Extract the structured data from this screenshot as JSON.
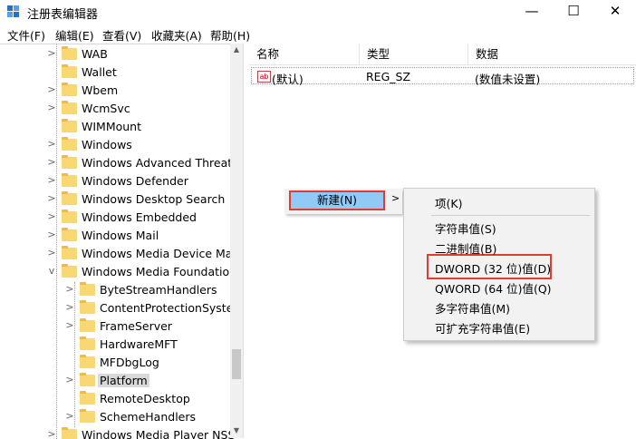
{
  "window": {
    "title": "注册表编辑器",
    "minimize": "—",
    "maximize": "☐",
    "close": "✕"
  },
  "menu": [
    "文件(F)",
    "编辑(E)",
    "查看(V)",
    "收藏夹(A)",
    "帮助(H)"
  ],
  "tree": [
    {
      "label": "WAB",
      "level": 1,
      "exp": ">"
    },
    {
      "label": "Wallet",
      "level": 1,
      "exp": ""
    },
    {
      "label": "Wbem",
      "level": 1,
      "exp": ">"
    },
    {
      "label": "WcmSvc",
      "level": 1,
      "exp": ">"
    },
    {
      "label": "WIMMount",
      "level": 1,
      "exp": ""
    },
    {
      "label": "Windows",
      "level": 1,
      "exp": ">"
    },
    {
      "label": "Windows Advanced Threat P",
      "level": 1,
      "exp": ">"
    },
    {
      "label": "Windows Defender",
      "level": 1,
      "exp": ">"
    },
    {
      "label": "Windows Desktop Search",
      "level": 1,
      "exp": ">"
    },
    {
      "label": "Windows Embedded",
      "level": 1,
      "exp": ">"
    },
    {
      "label": "Windows Mail",
      "level": 1,
      "exp": ">"
    },
    {
      "label": "Windows Media Device Man",
      "level": 1,
      "exp": ">"
    },
    {
      "label": "Windows Media Foundation",
      "level": 1,
      "exp": "v"
    },
    {
      "label": "ByteStreamHandlers",
      "level": 2,
      "exp": ">"
    },
    {
      "label": "ContentProtectionSystem",
      "level": 2,
      "exp": ">"
    },
    {
      "label": "FrameServer",
      "level": 2,
      "exp": ">"
    },
    {
      "label": "HardwareMFT",
      "level": 2,
      "exp": ""
    },
    {
      "label": "MFDbgLog",
      "level": 2,
      "exp": ""
    },
    {
      "label": "Platform",
      "level": 2,
      "exp": ">",
      "selected": true
    },
    {
      "label": "RemoteDesktop",
      "level": 2,
      "exp": ""
    },
    {
      "label": "SchemeHandlers",
      "level": 2,
      "exp": ">"
    },
    {
      "label": "Windows Media Player NSS",
      "level": 1,
      "exp": ">"
    }
  ],
  "columns": {
    "name": "名称",
    "type": "类型",
    "data": "数据"
  },
  "values": [
    {
      "icon": "ab",
      "name": "(默认)",
      "type": "REG_SZ",
      "data": "(数值未设置)"
    }
  ],
  "context_menu": {
    "new_label": "新建(N)",
    "arrow": ">"
  },
  "submenu": [
    {
      "label": "项(K)"
    },
    {
      "label": "字符串值(S)"
    },
    {
      "label": "二进制值(B)"
    },
    {
      "label": "DWORD (32 位)值(D)",
      "highlighted": true
    },
    {
      "label": "QWORD (64 位)值(Q)"
    },
    {
      "label": "多字符串值(M)"
    },
    {
      "label": "可扩充字符串值(E)"
    }
  ],
  "colors": {
    "selection": "#91c9f7",
    "annotation": "#e03c31",
    "folder": "#f8d775"
  }
}
